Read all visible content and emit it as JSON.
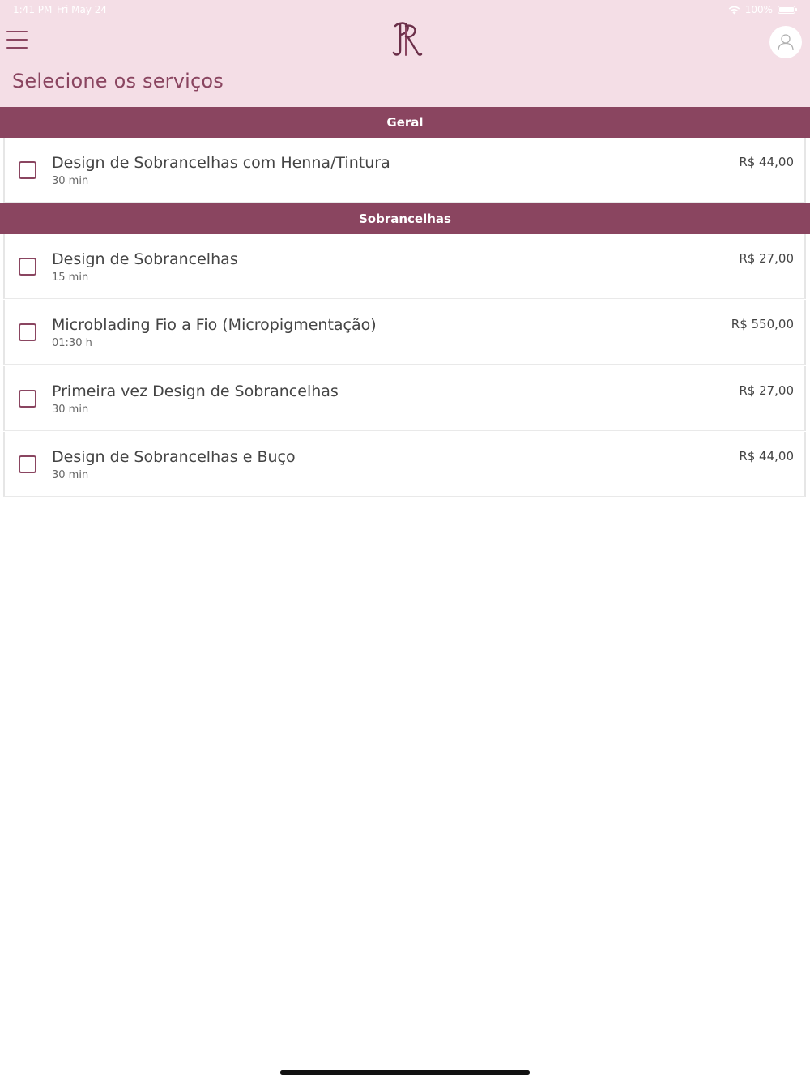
{
  "status_bar": {
    "time": "1:41 PM",
    "date": "Fri May 24",
    "battery": "100%",
    "wifi_icon": "wifi-icon",
    "battery_icon": "battery-icon"
  },
  "header": {
    "menu_icon": "hamburger-menu-icon",
    "logo_icon": "brand-monogram-logo",
    "profile_icon": "user-profile-icon",
    "title": "Selecione os serviços",
    "background_color": "#f4dee6",
    "accent_color": "#8a4560"
  },
  "sections": [
    {
      "title": "Geral",
      "services": [
        {
          "name": "Design de Sobrancelhas com Henna/Tintura",
          "duration": "30 min",
          "price": "R$ 44,00",
          "selected": false
        }
      ]
    },
    {
      "title": "Sobrancelhas",
      "services": [
        {
          "name": "Design de Sobrancelhas",
          "duration": "15 min",
          "price": "R$ 27,00",
          "selected": false
        },
        {
          "name": "Microblading Fio a Fio (Micropigmentação)",
          "duration": "01:30 h",
          "price": "R$ 550,00",
          "selected": false
        },
        {
          "name": "Primeira vez Design de Sobrancelhas",
          "duration": "30 min",
          "price": "R$ 27,00",
          "selected": false
        },
        {
          "name": "Design de Sobrancelhas e Buço",
          "duration": "30 min",
          "price": "R$ 44,00",
          "selected": false
        }
      ]
    }
  ]
}
